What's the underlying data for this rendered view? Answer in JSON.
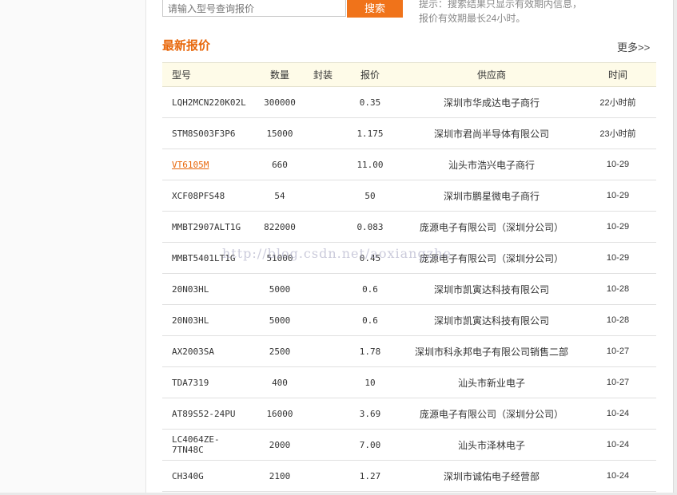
{
  "search": {
    "placeholder": "请输入型号查询报价",
    "button_label": "搜索",
    "hint_line1": "提示：搜索结果只显示有效期内信息，",
    "hint_line2": "报价有效期最长24小时。"
  },
  "section": {
    "title": "最新报价",
    "more_label": "更多>>"
  },
  "table": {
    "headers": {
      "model": "型号",
      "quantity": "数量",
      "package": "封装",
      "price": "报价",
      "supplier": "供应商",
      "time": "时间"
    },
    "rows": [
      {
        "model": "LQH2MCN220K02L",
        "quantity": "300000",
        "package": "",
        "price": "0.35",
        "supplier": "深圳市华成达电子商行",
        "time": "22小时前",
        "link": false
      },
      {
        "model": "STM8S003F3P6",
        "quantity": "15000",
        "package": "",
        "price": "1.175",
        "supplier": "深圳市君尚半导体有限公司",
        "time": "23小时前",
        "link": false
      },
      {
        "model": "VT6105M",
        "quantity": "660",
        "package": "",
        "price": "11.00",
        "supplier": "汕头市浩兴电子商行",
        "time": "10-29",
        "link": true
      },
      {
        "model": "XCF08PFS48",
        "quantity": "54",
        "package": "",
        "price": "50",
        "supplier": "深圳市鹏星微电子商行",
        "time": "10-29",
        "link": false
      },
      {
        "model": "MMBT2907ALT1G",
        "quantity": "822000",
        "package": "",
        "price": "0.083",
        "supplier": "庞源电子有限公司（深圳分公司）",
        "time": "10-29",
        "link": false
      },
      {
        "model": "MMBT5401LT1G",
        "quantity": "51000",
        "package": "",
        "price": "0.45",
        "supplier": "庞源电子有限公司（深圳分公司）",
        "time": "10-29",
        "link": false
      },
      {
        "model": "20N03HL",
        "quantity": "5000",
        "package": "",
        "price": "0.6",
        "supplier": "深圳市凯寅达科技有限公司",
        "time": "10-28",
        "link": false
      },
      {
        "model": "20N03HL",
        "quantity": "5000",
        "package": "",
        "price": "0.6",
        "supplier": "深圳市凯寅达科技有限公司",
        "time": "10-28",
        "link": false
      },
      {
        "model": "AX2003SA",
        "quantity": "2500",
        "package": "",
        "price": "1.78",
        "supplier": "深圳市科永邦电子有限公司销售二部",
        "time": "10-27",
        "link": false
      },
      {
        "model": "TDA7319",
        "quantity": "400",
        "package": "",
        "price": "10",
        "supplier": "汕头市新业电子",
        "time": "10-27",
        "link": false
      },
      {
        "model": "AT89S52-24PU",
        "quantity": "16000",
        "package": "",
        "price": "3.69",
        "supplier": "庞源电子有限公司（深圳分公司）",
        "time": "10-24",
        "link": false
      },
      {
        "model": "LC4064ZE-7TN48C",
        "quantity": "2000",
        "package": "",
        "price": "7.00",
        "supplier": "汕头市泽林电子",
        "time": "10-24",
        "link": false
      },
      {
        "model": "CH340G",
        "quantity": "2100",
        "package": "",
        "price": "1.27",
        "supplier": "深圳市诚佑电子经营部",
        "time": "10-24",
        "link": false
      }
    ]
  },
  "watermark": "http://blog.csdn.net/aoxiangzhe",
  "colors": {
    "accent": "#e8670b",
    "button": "#f0731a",
    "header_bg": "#fefbe8"
  }
}
